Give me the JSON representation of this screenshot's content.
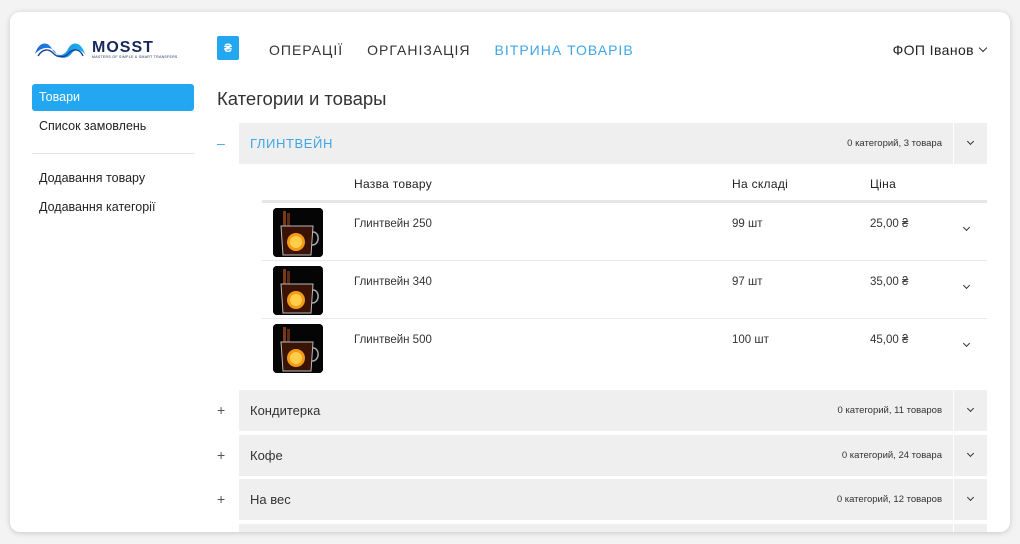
{
  "brand": {
    "name": "MOSST",
    "tagline": "MASTERS OF SIMPLE & SMART TRANSFERS"
  },
  "app_icon": {
    "glyph": "₴",
    "color": "#22a7f0"
  },
  "topnav": [
    {
      "label": "ОПЕРАЦІЇ"
    },
    {
      "label": "ОРГАНІЗАЦІЯ"
    },
    {
      "label": "ВІТРИНА ТОВАРІВ",
      "active": true
    }
  ],
  "user": {
    "label": "ФОП Іванов"
  },
  "sidebar": {
    "items": [
      {
        "label": "Товари",
        "active": true
      },
      {
        "label": "Список замовлень"
      },
      {
        "label": "Додавання товару"
      },
      {
        "label": "Додавання категорії"
      }
    ]
  },
  "page_title": "Категории и товары",
  "categories": [
    {
      "toggle": "–",
      "name": "ГЛИНТВЕЙН",
      "count": "0 категорий, 3 товара",
      "open": true
    },
    {
      "toggle": "+",
      "name": "Кондитерка",
      "count": "0 категорий, 11 товаров"
    },
    {
      "toggle": "+",
      "name": "Кофе",
      "count": "0 категорий, 24 товара"
    },
    {
      "toggle": "+",
      "name": "На вес",
      "count": "0 категорий, 12 товаров"
    }
  ],
  "products": {
    "headers": {
      "name": "Назва товару",
      "stock": "На складі",
      "price": "Ціна"
    },
    "rows": [
      {
        "name": "Глинтвейн 250",
        "stock": "99 шт",
        "price": "25,00 ₴"
      },
      {
        "name": "Глинтвейн 340",
        "stock": "97 шт",
        "price": "35,00 ₴"
      },
      {
        "name": "Глинтвейн 500",
        "stock": "100 шт",
        "price": "45,00 ₴"
      }
    ]
  },
  "colors": {
    "accent": "#22a7f0",
    "accent_text": "#3fa6e6",
    "category_bg": "#efefef"
  },
  "icons": [
    "chevron-down-icon",
    "mulled-wine-thumbnail"
  ]
}
